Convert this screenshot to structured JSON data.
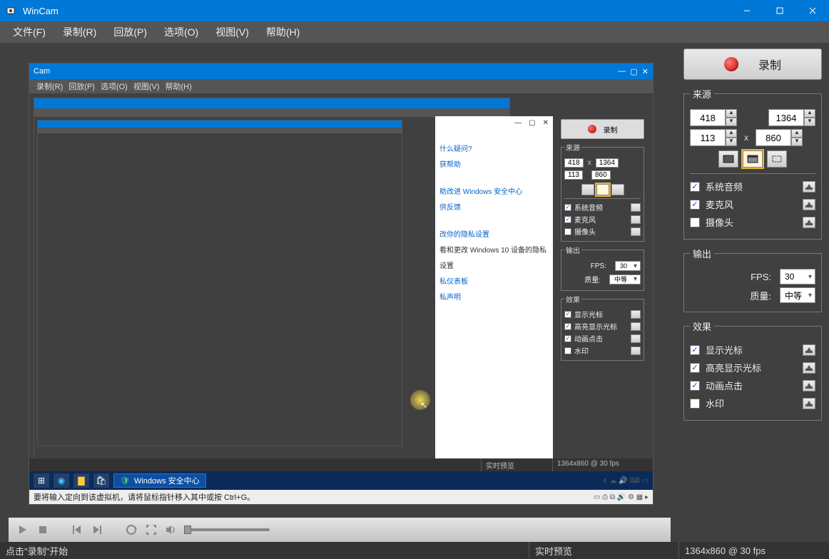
{
  "app": {
    "title": "WinCam"
  },
  "menu": {
    "file": "文件(F)",
    "record": "录制(R)",
    "playback": "回放(P)",
    "options": "选项(O)",
    "view": "视图(V)",
    "help": "帮助(H)"
  },
  "record_button": "录制",
  "source": {
    "legend": "来源",
    "x": "418",
    "y": "113",
    "w": "1364",
    "h": "860",
    "sys_audio": "系统音频",
    "mic": "麦克风",
    "camera": "摄像头",
    "sys_audio_checked": true,
    "mic_checked": true,
    "camera_checked": false
  },
  "output": {
    "legend": "输出",
    "fps_label": "FPS:",
    "fps_value": "30",
    "quality_label": "质量:",
    "quality_value": "中等"
  },
  "effects": {
    "legend": "效果",
    "show_cursor": "显示光标",
    "highlight_cursor": "高亮显示光标",
    "animate_click": "动画点击",
    "watermark": "水印",
    "show_cursor_checked": true,
    "highlight_cursor_checked": true,
    "animate_click_checked": true,
    "watermark_checked": false
  },
  "status": {
    "left": "点击\"录制\"开始",
    "mid": "实时预览",
    "right": "1364x860 @ 30 fps"
  },
  "nested": {
    "title": "Cam",
    "menu": [
      "录制(R)",
      "回放(P)",
      "选项(O)",
      "视图(V)",
      "帮助(H)"
    ],
    "record": "录制",
    "source_legend": "来源",
    "output_legend": "输出",
    "effects_legend": "效果",
    "vals": {
      "x": "418",
      "y": "113",
      "w": "1364",
      "h": "860"
    },
    "fps_label": "FPS:",
    "fps_value": "30",
    "q_label": "质量:",
    "q_value": "中等",
    "chks": [
      "系统音频",
      "麦克风",
      "摄像头"
    ],
    "eff": [
      "显示光标",
      "高亮显示光标",
      "动画点击",
      "水印"
    ],
    "white_lines": [
      "什么疑问?",
      "获帮助",
      "助改进 Windows 安全中心",
      "供反馈",
      "改你的隐私设置",
      "看和更改 Windows 10 设备的隐私",
      "设置",
      "私仪表板",
      "私声明"
    ],
    "taskbar_app": "Windows 安全中心",
    "hint": "要将输入定向到该虚拟机，请将鼠标指针移入其中或按 Ctrl+G。",
    "status_mid": "实时预览",
    "status_right": "1364x860 @ 30 fps"
  }
}
